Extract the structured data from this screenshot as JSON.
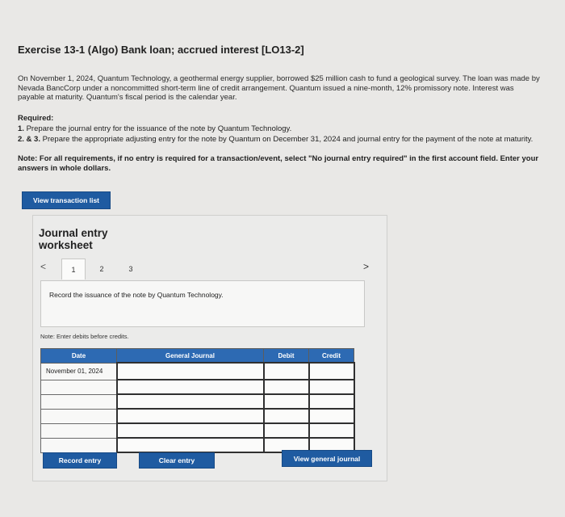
{
  "exercise": {
    "title": "Exercise 13-1 (Algo) Bank loan; accrued interest [LO13-2]",
    "description": "On November 1, 2024, Quantum Technology, a geothermal energy supplier, borrowed $25 million cash to fund a geological survey. The loan was made by Nevada BancCorp under a noncommitted short-term line of credit arrangement. Quantum issued a nine-month, 12% promissory note. Interest was payable at maturity. Quantum's fiscal period is the calendar year.",
    "required_heading": "Required:",
    "req1_num": "1.",
    "req1_text": "Prepare the journal entry for the issuance of the note by Quantum Technology.",
    "req2_num": "2. & 3.",
    "req2_text": "Prepare the appropriate adjusting entry for the note by Quantum on December 31, 2024 and journal entry for the payment of the note at maturity.",
    "note_text": "Note: For all requirements, if no entry is required for a transaction/event, select \"No journal entry required\" in the first account field. Enter your answers in whole dollars."
  },
  "buttons": {
    "view_transaction_list": "View transaction list",
    "record_entry": "Record entry",
    "clear_entry": "Clear entry",
    "view_general_journal": "View general journal"
  },
  "worksheet": {
    "title_line1": "Journal entry",
    "title_line2": "worksheet",
    "pages": [
      "1",
      "2",
      "3"
    ],
    "prev_icon": "<",
    "next_icon": ">",
    "instruction": "Record the issuance of the note by Quantum Technology.",
    "debits_note": "Note: Enter debits before credits.",
    "columns": {
      "date": "Date",
      "general_journal": "General Journal",
      "debit": "Debit",
      "credit": "Credit"
    },
    "rows": [
      {
        "date": "November 01, 2024",
        "account": "",
        "debit": "",
        "credit": ""
      },
      {
        "date": "",
        "account": "",
        "debit": "",
        "credit": ""
      },
      {
        "date": "",
        "account": "",
        "debit": "",
        "credit": ""
      },
      {
        "date": "",
        "account": "",
        "debit": "",
        "credit": ""
      },
      {
        "date": "",
        "account": "",
        "debit": "",
        "credit": ""
      },
      {
        "date": "",
        "account": "",
        "debit": "",
        "credit": ""
      }
    ]
  },
  "colors": {
    "button_blue": "#1f5ba1",
    "header_blue": "#2d6ab3",
    "background": "#e9e8e6"
  }
}
